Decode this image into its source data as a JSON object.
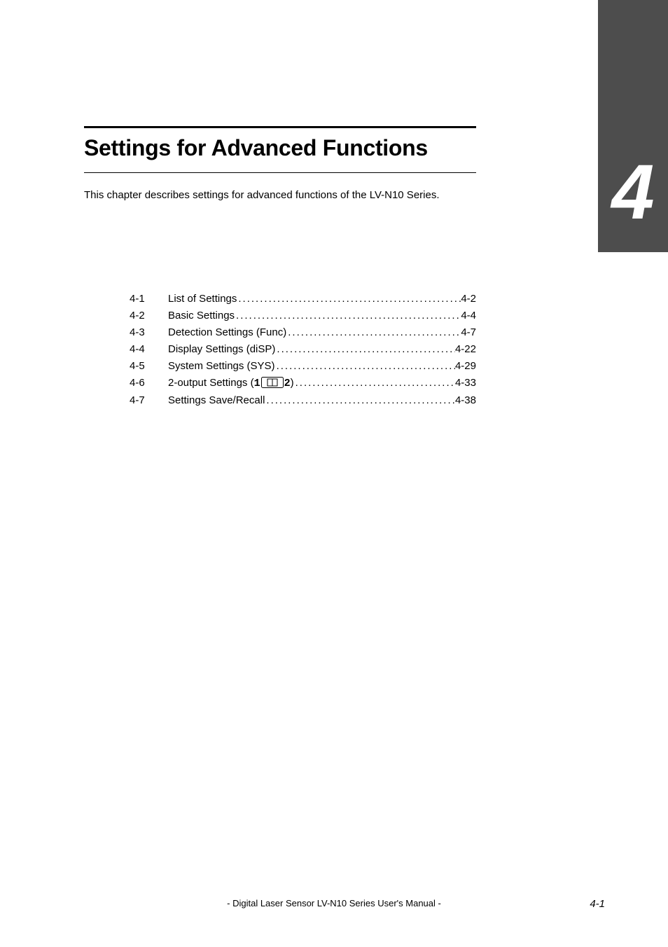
{
  "chapter_number": "4",
  "chapter_title": "Settings for Advanced Functions",
  "chapter_intro": "This chapter describes settings for advanced functions of the LV-N10 Series.",
  "toc": [
    {
      "num": "4-1",
      "label": "List of Settings",
      "page": "4-2"
    },
    {
      "num": "4-2",
      "label": "Basic Settings",
      "page": "4-4"
    },
    {
      "num": "4-3",
      "label": "Detection Settings (Func)",
      "page": "4-7"
    },
    {
      "num": "4-4",
      "label": "Display Settings (diSP)",
      "page": "4-22"
    },
    {
      "num": "4-5",
      "label": "System Settings (SYS)",
      "page": "4-29"
    },
    {
      "num": "4-6",
      "label_pre": "2-output Settings (",
      "label_1": "1",
      "label_2": "2",
      "label_post": ") ",
      "page": "4-33",
      "has_icon": true
    },
    {
      "num": "4-7",
      "label": "Settings Save/Recall",
      "page": "4-38"
    }
  ],
  "footer_center": "- Digital Laser Sensor LV-N10 Series User's Manual -",
  "footer_page": "4-1"
}
